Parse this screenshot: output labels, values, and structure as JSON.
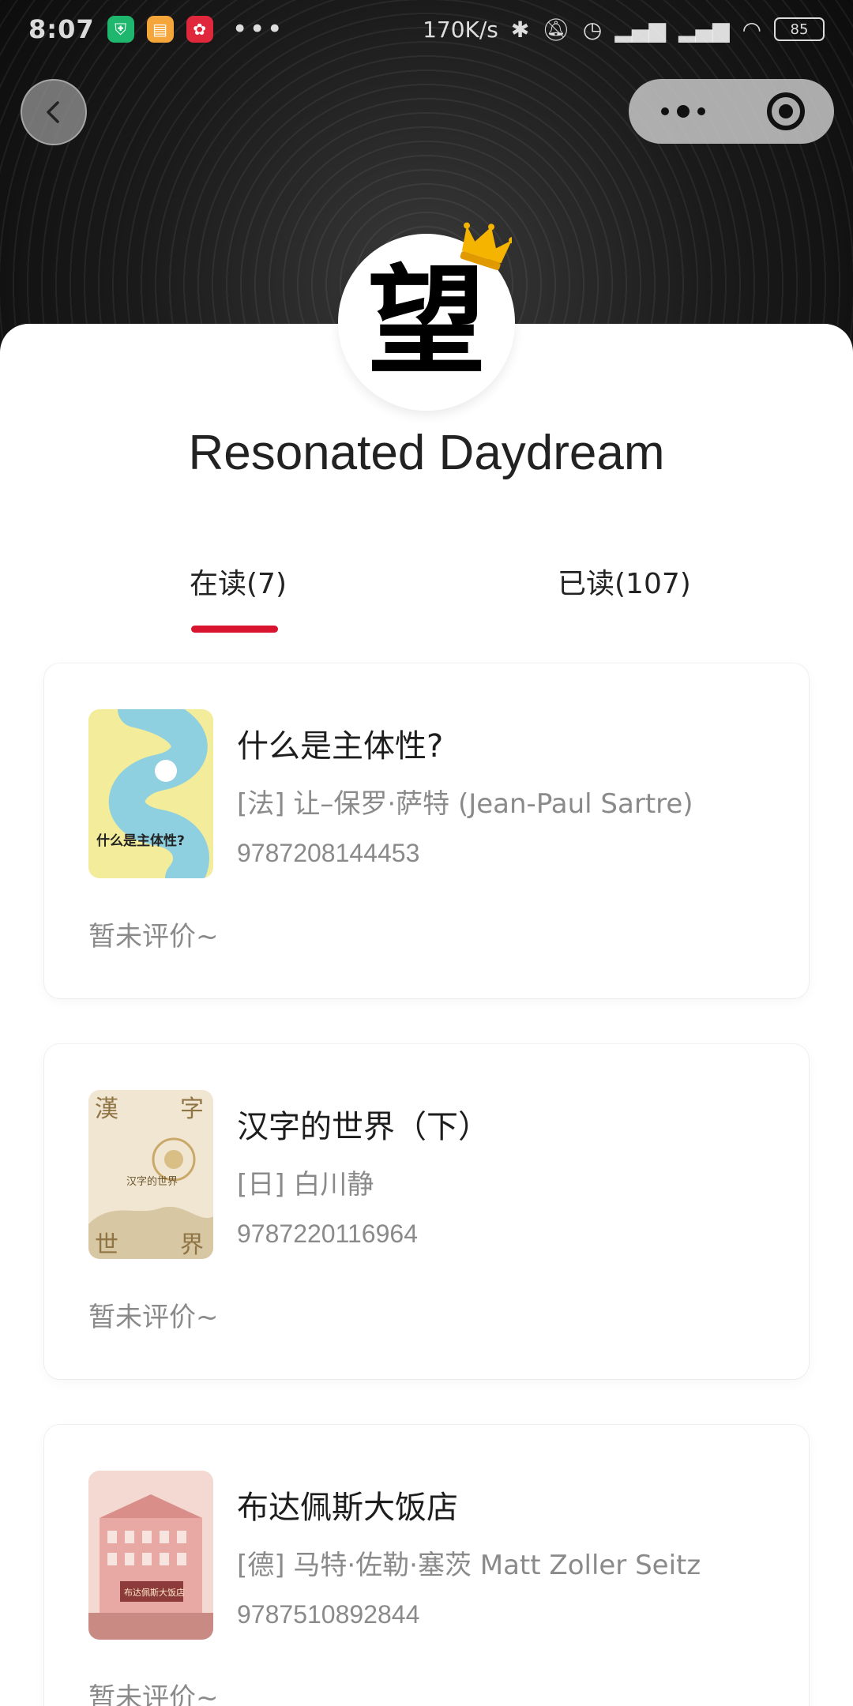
{
  "status_bar": {
    "time": "8:07",
    "speed": "170K/s",
    "battery": "85",
    "more": "•••"
  },
  "profile": {
    "avatar_glyph": "望",
    "username": "Resonated Daydream"
  },
  "tabs": [
    {
      "label": "在读(7)",
      "active": true
    },
    {
      "label": "已读(107)",
      "active": false
    }
  ],
  "books": [
    {
      "title": "什么是主体性?",
      "author": "[法] 让–保罗·萨特 (Jean-Paul Sartre)",
      "isbn": "9787208144453",
      "review": "暂未评价~",
      "cover_text": "什么是主体性?"
    },
    {
      "title": "汉字的世界（下）",
      "author": "[日] 白川静",
      "isbn": "9787220116964",
      "review": "暂未评价~",
      "cover_text": "汉字的世界"
    },
    {
      "title": "布达佩斯大饭店",
      "author": "[德] 马特·佐勒·塞茨 Matt Zoller Seitz",
      "isbn": "9787510892844",
      "review": "暂未评价~",
      "cover_text": "布达佩斯大饭店"
    }
  ],
  "colors": {
    "accent": "#d8142f",
    "secondary_text": "#8a8a8a"
  }
}
